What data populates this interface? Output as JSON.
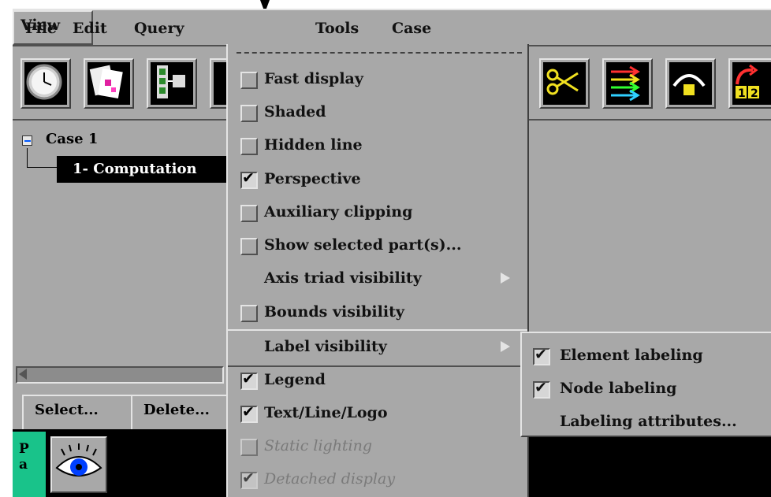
{
  "menubar": {
    "items": [
      {
        "label": "File"
      },
      {
        "label": "Edit"
      },
      {
        "label": "Query"
      },
      {
        "label": "View"
      },
      {
        "label": "Tools"
      },
      {
        "label": "Case"
      }
    ]
  },
  "tree": {
    "case_label": "Case 1",
    "part_label": "1- Computation"
  },
  "buttons": {
    "select_label": "Select...",
    "delete_label": "Delete..."
  },
  "parts_tab": {
    "line1": "P",
    "line2": "a"
  },
  "view_menu": {
    "items": [
      {
        "label": "Fast display",
        "checked": false,
        "enabled": true
      },
      {
        "label": "Shaded",
        "checked": false,
        "enabled": true
      },
      {
        "label": "Hidden line",
        "checked": false,
        "enabled": true
      },
      {
        "label": "Perspective",
        "checked": true,
        "enabled": true
      },
      {
        "label": "Auxiliary clipping",
        "checked": false,
        "enabled": true
      },
      {
        "label": "Show selected part(s)...",
        "checked": false,
        "enabled": true
      },
      {
        "label": "Axis triad visibility",
        "submenu": true,
        "enabled": true
      },
      {
        "label": "Bounds visibility",
        "checked": false,
        "enabled": true
      },
      {
        "label": "Label visibility",
        "submenu": true,
        "enabled": true,
        "active": true
      },
      {
        "label": "Legend",
        "checked": true,
        "enabled": true
      },
      {
        "label": "Text/Line/Logo",
        "checked": true,
        "enabled": true
      },
      {
        "label": "Static lighting",
        "checked": false,
        "enabled": false
      },
      {
        "label": "Detached display",
        "checked": true,
        "enabled": false
      }
    ]
  },
  "label_submenu": {
    "items": [
      {
        "label": "Element labeling",
        "checked": true
      },
      {
        "label": "Node labeling",
        "checked": true
      },
      {
        "label": "Labeling attributes..."
      }
    ]
  },
  "colors": {
    "panel": "#a8a8a8",
    "parts_tab": "#19c38a"
  }
}
